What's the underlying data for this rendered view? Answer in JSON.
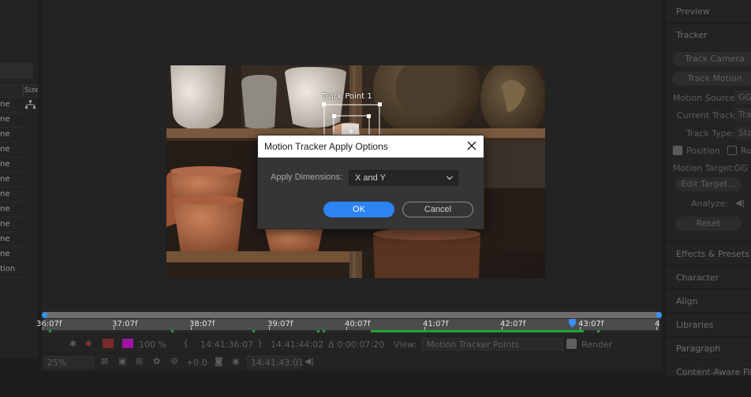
{
  "project_panel": {
    "size_header": "Size",
    "rows": [
      "ne",
      "ne",
      "ne",
      "ne",
      "ne",
      "ne",
      "ne",
      "ne",
      "ne",
      "ne",
      "ne",
      "tion"
    ]
  },
  "viewer": {
    "track_point_label": "Track Point 1"
  },
  "timeline": {
    "ticks": [
      "36:07f",
      "37:07f",
      "38:07f",
      "39:07f",
      "40:07f",
      "41:07f",
      "42:07f",
      "43:07f",
      "4"
    ]
  },
  "toolbar1": {
    "zoom_percent": "100 %",
    "time_in": "14:41:36:07",
    "time_out": "14:41:44:02",
    "duration": "Δ 0:00:07:20",
    "view_label": "View:",
    "view_value": "Motion Tracker Points",
    "render_label": "Render"
  },
  "toolbar2": {
    "magnification": "25%",
    "exposure": "+0.0",
    "timecode": "14:41:43:01"
  },
  "right_panels": {
    "preview": "Preview",
    "tracker": "Tracker",
    "track_camera": "Track Camera",
    "track_motion": "Track Motion",
    "motion_source_label": "Motion Source:",
    "motion_source_value": "GG",
    "current_track_label": "Current Track:",
    "current_track_value": "Tra",
    "track_type_label": "Track Type:",
    "track_type_value": "Sta",
    "position_label": "Position",
    "rotation_label": "Ro",
    "motion_target_label": "Motion Target:",
    "motion_target_value": "GG",
    "edit_target": "Edit Target...",
    "analyze_label": "Analyze:",
    "reset": "Reset",
    "effects_presets": "Effects & Presets",
    "character": "Character",
    "align": "Align",
    "libraries": "Libraries",
    "paragraph": "Paragraph",
    "content_aware": "Content-Aware Fill"
  },
  "dialog": {
    "title": "Motion Tracker Apply Options",
    "dimensions_label": "Apply Dimensions:",
    "dimensions_value": "X and Y",
    "ok_label": "OK",
    "cancel_label": "Cancel"
  }
}
